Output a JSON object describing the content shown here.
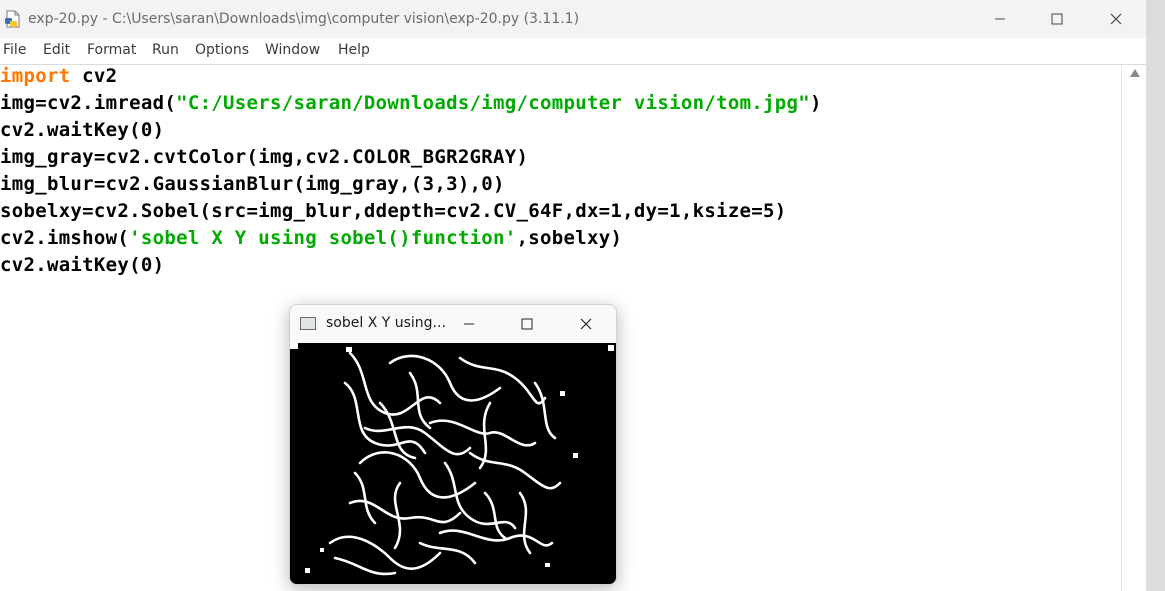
{
  "window": {
    "title": "exp-20.py - C:\\Users\\saran\\Downloads\\img\\computer vision\\exp-20.py (3.11.1)",
    "icon": "python-file-icon"
  },
  "menu": {
    "items": [
      "File",
      "Edit",
      "Format",
      "Run",
      "Options",
      "Window",
      "Help"
    ]
  },
  "code": {
    "lines": [
      [
        {
          "t": "import",
          "c": "kw"
        },
        {
          "t": " cv2",
          "c": ""
        }
      ],
      [
        {
          "t": "img=cv2.imread(",
          "c": ""
        },
        {
          "t": "\"C:/Users/saran/Downloads/img/computer vision/tom.jpg\"",
          "c": "str"
        },
        {
          "t": ")",
          "c": ""
        }
      ],
      [
        {
          "t": "cv2.waitKey(0)",
          "c": ""
        }
      ],
      [
        {
          "t": "img_gray=cv2.cvtColor(img,cv2.COLOR_BGR2GRAY)",
          "c": ""
        }
      ],
      [
        {
          "t": "img_blur=cv2.GaussianBlur(img_gray,(3,3),0)",
          "c": ""
        }
      ],
      [
        {
          "t": "sobelxy=cv2.Sobel(src=img_blur,ddepth=cv2.CV_64F,dx=1,dy=1,ksize=5)",
          "c": ""
        }
      ],
      [
        {
          "t": "cv2.imshow(",
          "c": ""
        },
        {
          "t": "'sobel X Y using sobel()function'",
          "c": "str"
        },
        {
          "t": ",sobelxy)",
          "c": ""
        }
      ],
      [
        {
          "t": "cv2.waitKey(0)",
          "c": ""
        }
      ]
    ]
  },
  "colors": {
    "keyword": "#ff7700",
    "string": "#00aa00"
  },
  "cv_window": {
    "title": "sobel X Y using..."
  }
}
